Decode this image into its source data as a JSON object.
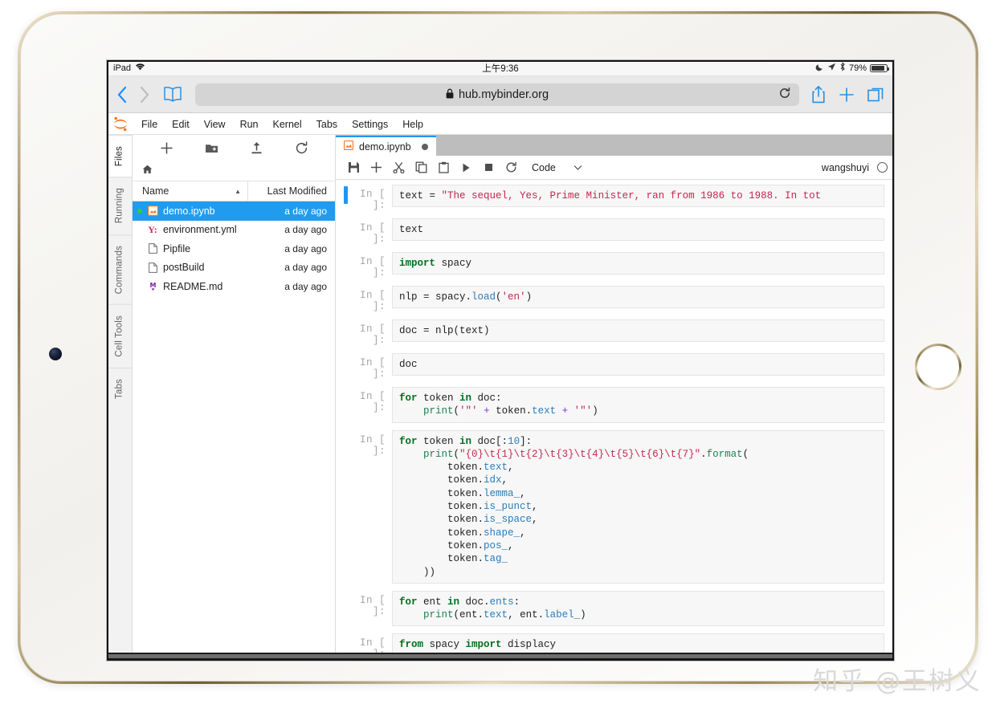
{
  "device": {
    "name": "ipad-gold"
  },
  "status_bar": {
    "device_label": "iPad",
    "wifi_icon": "wifi-icon",
    "time": "上午9:36",
    "dnd_icon": "moon-icon",
    "location_icon": "location-arrow-icon",
    "bluetooth_icon": "bluetooth-icon",
    "battery_percent": "79%"
  },
  "safari": {
    "back_icon": "chevron-left-icon",
    "forward_icon": "chevron-right-icon",
    "bookmarks_icon": "book-icon",
    "lock_icon": "lock-icon",
    "url": "hub.mybinder.org",
    "reload_icon": "reload-icon",
    "share_icon": "share-icon",
    "new_tab_icon": "plus-icon",
    "tabs_icon": "tabs-icon"
  },
  "jupyter": {
    "logo": "jupyter-logo",
    "menu": [
      "File",
      "Edit",
      "View",
      "Run",
      "Kernel",
      "Tabs",
      "Settings",
      "Help"
    ],
    "rail_tabs": [
      {
        "label": "Files",
        "active": true
      },
      {
        "label": "Running",
        "active": false
      },
      {
        "label": "Commands",
        "active": false
      },
      {
        "label": "Cell Tools",
        "active": false
      },
      {
        "label": "Tabs",
        "active": false
      }
    ],
    "file_browser": {
      "toolbar": [
        {
          "name": "new-launcher-button",
          "icon": "plus-icon"
        },
        {
          "name": "new-folder-button",
          "icon": "new-folder-icon"
        },
        {
          "name": "upload-button",
          "icon": "upload-icon"
        },
        {
          "name": "refresh-button",
          "icon": "refresh-icon"
        }
      ],
      "breadcrumb_icon": "home-icon",
      "columns": {
        "name": "Name",
        "last_modified": "Last Modified"
      },
      "sort_caret": "▲",
      "files": [
        {
          "name": "demo.ipynb",
          "modified": "a day ago",
          "icon": "notebook-icon",
          "icon_glyph": "▣",
          "icon_color": "#f37726",
          "selected": true,
          "running": true
        },
        {
          "name": "environment.yml",
          "modified": "a day ago",
          "icon": "yaml-icon",
          "icon_glyph": "Y:",
          "icon_color": "#d42a5b",
          "selected": false,
          "running": false
        },
        {
          "name": "Pipfile",
          "modified": "a day ago",
          "icon": "file-icon",
          "icon_glyph": "🗋",
          "icon_color": "#6f6f6f",
          "selected": false,
          "running": false
        },
        {
          "name": "postBuild",
          "modified": "a day ago",
          "icon": "file-icon",
          "icon_glyph": "🗋",
          "icon_color": "#6f6f6f",
          "selected": false,
          "running": false
        },
        {
          "name": "README.md",
          "modified": "a day ago",
          "icon": "markdown-icon",
          "icon_glyph": "M",
          "icon_color": "#7b1fa2",
          "selected": false,
          "running": false
        }
      ]
    },
    "notebook": {
      "tab_label": "demo.ipynb",
      "tab_icon": "notebook-icon",
      "dirty_indicator": "unsaved-dot",
      "toolbar": [
        {
          "name": "save-button",
          "icon": "save-icon"
        },
        {
          "name": "insert-cell-button",
          "icon": "plus-icon"
        },
        {
          "name": "cut-button",
          "icon": "scissors-icon"
        },
        {
          "name": "copy-button",
          "icon": "copy-icon"
        },
        {
          "name": "paste-button",
          "icon": "paste-icon"
        },
        {
          "name": "run-button",
          "icon": "play-icon"
        },
        {
          "name": "stop-button",
          "icon": "stop-icon"
        },
        {
          "name": "restart-button",
          "icon": "restart-icon"
        }
      ],
      "cell_type": "Code",
      "cell_type_caret": "chevron-down-icon",
      "kernel_name": "wangshuyi",
      "kernel_status_icon": "kernel-idle-circle",
      "cells": [
        {
          "prompt": "In [ ]:",
          "active": true,
          "lines": 1
        },
        {
          "prompt": "In [ ]:",
          "active": false,
          "lines": 1
        },
        {
          "prompt": "In [ ]:",
          "active": false,
          "lines": 1
        },
        {
          "prompt": "In [ ]:",
          "active": false,
          "lines": 1
        },
        {
          "prompt": "In [ ]:",
          "active": false,
          "lines": 1
        },
        {
          "prompt": "In [ ]:",
          "active": false,
          "lines": 1
        },
        {
          "prompt": "In [ ]:",
          "active": false,
          "lines": 2
        },
        {
          "prompt": "In [ ]:",
          "active": false,
          "lines": 11
        },
        {
          "prompt": "In [ ]:",
          "active": false,
          "lines": 2
        },
        {
          "prompt": "In [ ]:",
          "active": false,
          "lines": 2
        }
      ],
      "cell_source": [
        "text = \"The sequel, Yes, Prime Minister, ran from 1986 to 1988. In tot",
        "text",
        "import spacy",
        "nlp = spacy.load('en')",
        "doc = nlp(text)",
        "doc",
        "for token in doc:\n    print('\"' + token.text + '\"')",
        "for token in doc[:10]:\n    print(\"{0}\\t{1}\\t{2}\\t{3}\\t{4}\\t{5}\\t{6}\\t{7}\".format(\n        token.text,\n        token.idx,\n        token.lemma_,\n        token.is_punct,\n        token.is_space,\n        token.shape_,\n        token.pos_,\n        token.tag_\n    ))",
        "for ent in doc.ents:\n    print(ent.text, ent.label_)",
        "from spacy import displacy\ndisplacy.render(doc, style='ent', jupyter=True)"
      ]
    }
  },
  "watermark": {
    "text": "知乎 @王树义"
  },
  "colors": {
    "accent": "#2196f3",
    "selection": "#1f9cf0",
    "jupyter_orange": "#f37726",
    "running_green": "#2ecc40",
    "safari_blue": "#2a8fe0"
  }
}
